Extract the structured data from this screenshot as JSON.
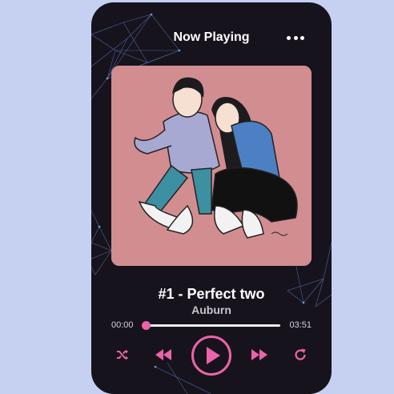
{
  "header": {
    "title": "Now Playing",
    "more_icon": "more-dots-icon"
  },
  "album_art": {
    "description_icon": "album-art-couple-illustration"
  },
  "song": {
    "title": "#1 - Perfect two",
    "artist": "Auburn"
  },
  "progress": {
    "current": "00:00",
    "duration": "03:51",
    "fraction": 0
  },
  "controls": {
    "icons": [
      "shuffle-icon",
      "rewind-icon",
      "play-icon",
      "fast-forward-icon",
      "repeat-icon"
    ],
    "accent": "#ec63a8"
  },
  "colors": {
    "background": "#c6d1f2",
    "card": "#17131d",
    "accent": "#ec63a8"
  }
}
